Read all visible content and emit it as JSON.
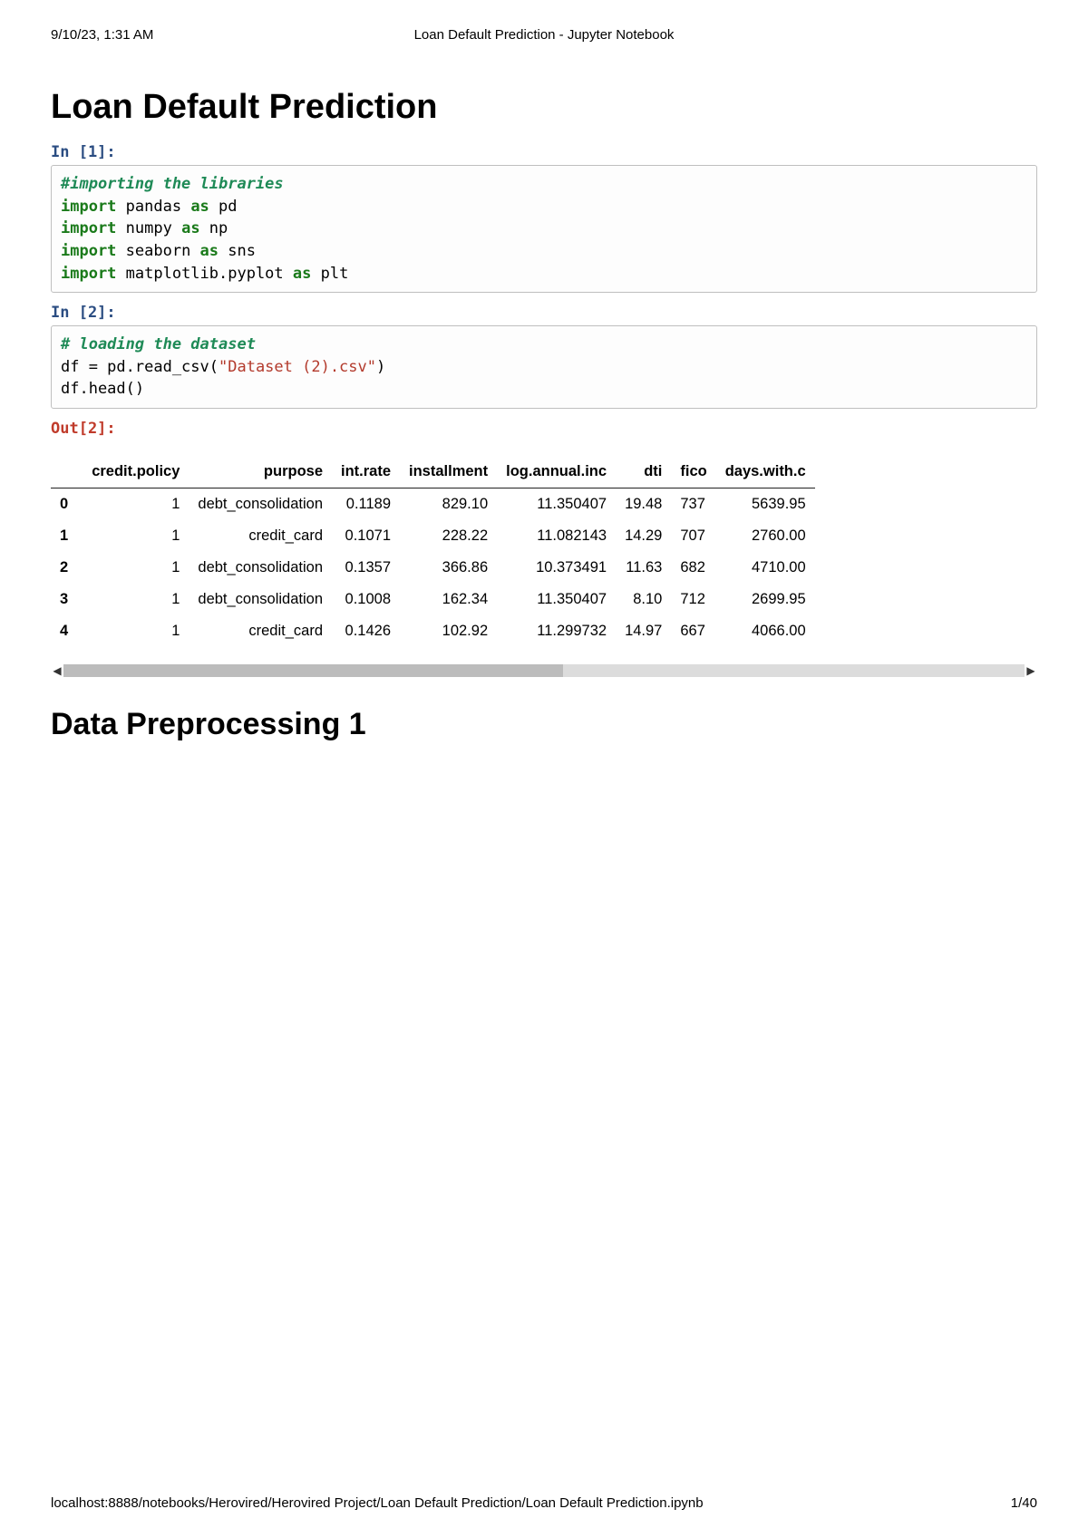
{
  "print_header": {
    "left": "9/10/23, 1:31 AM",
    "center": "Loan Default Prediction - Jupyter Notebook"
  },
  "title": "Loan Default Prediction",
  "cells": {
    "in1_prompt": "In [1]:",
    "in1_comment": "#importing the libraries",
    "in1_l1_kw1": "import",
    "in1_l1_m": " pandas ",
    "in1_l1_kw2": "as",
    "in1_l1_a": " pd",
    "in1_l2_kw1": "import",
    "in1_l2_m": " numpy ",
    "in1_l2_kw2": "as",
    "in1_l2_a": " np",
    "in1_l3_kw1": "import",
    "in1_l3_m": " seaborn ",
    "in1_l3_kw2": "as",
    "in1_l3_a": " sns",
    "in1_l4_kw1": "import",
    "in1_l4_m": " matplotlib.pyplot ",
    "in1_l4_kw2": "as",
    "in1_l4_a": " plt",
    "in2_prompt": "In [2]:",
    "in2_comment": "# loading the dataset",
    "in2_l1a": "df = pd.read_csv(",
    "in2_l1s": "\"Dataset (2).csv\"",
    "in2_l1b": ")",
    "in2_l2": "df.head()",
    "out2_prompt": "Out[2]:"
  },
  "table": {
    "headers": [
      "",
      "credit.policy",
      "purpose",
      "int.rate",
      "installment",
      "log.annual.inc",
      "dti",
      "fico",
      "days.with.c"
    ],
    "rows": [
      {
        "idx": "0",
        "credit_policy": "1",
        "purpose": "debt_consolidation",
        "int_rate": "0.1189",
        "installment": "829.10",
        "log_annual_inc": "11.350407",
        "dti": "19.48",
        "fico": "737",
        "days_with_c": "5639.95"
      },
      {
        "idx": "1",
        "credit_policy": "1",
        "purpose": "credit_card",
        "int_rate": "0.1071",
        "installment": "228.22",
        "log_annual_inc": "11.082143",
        "dti": "14.29",
        "fico": "707",
        "days_with_c": "2760.00"
      },
      {
        "idx": "2",
        "credit_policy": "1",
        "purpose": "debt_consolidation",
        "int_rate": "0.1357",
        "installment": "366.86",
        "log_annual_inc": "10.373491",
        "dti": "11.63",
        "fico": "682",
        "days_with_c": "4710.00"
      },
      {
        "idx": "3",
        "credit_policy": "1",
        "purpose": "debt_consolidation",
        "int_rate": "0.1008",
        "installment": "162.34",
        "log_annual_inc": "11.350407",
        "dti": "8.10",
        "fico": "712",
        "days_with_c": "2699.95"
      },
      {
        "idx": "4",
        "credit_policy": "1",
        "purpose": "credit_card",
        "int_rate": "0.1426",
        "installment": "102.92",
        "log_annual_inc": "11.299732",
        "dti": "14.97",
        "fico": "667",
        "days_with_c": "4066.00"
      }
    ]
  },
  "section2": "Data Preprocessing 1",
  "footer": {
    "url": "localhost:8888/notebooks/Herovired/Herovired Project/Loan Default Prediction/Loan Default Prediction.ipynb",
    "page": "1/40"
  },
  "scroll_arrows": {
    "left": "◀",
    "right": "▶"
  }
}
